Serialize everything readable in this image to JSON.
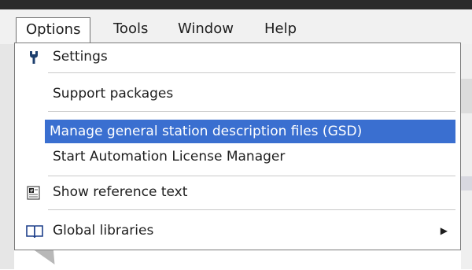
{
  "menubar": {
    "items": [
      {
        "label": "Options",
        "open": true
      },
      {
        "label": "Tools"
      },
      {
        "label": "Window"
      },
      {
        "label": "Help"
      }
    ]
  },
  "dropdown": {
    "items": [
      {
        "label": "Settings",
        "icon": "wrench-icon"
      },
      {
        "label": "Support packages"
      },
      {
        "label": "Manage general station description files (GSD)",
        "highlighted": true
      },
      {
        "label": "Start Automation License Manager"
      },
      {
        "label": "Show reference text",
        "icon": "reference-text-icon"
      },
      {
        "label": "Global libraries",
        "icon": "book-icon",
        "submenu": true
      }
    ]
  },
  "colors": {
    "highlight": "#3a6fd0",
    "menubar": "#f1f1f1"
  }
}
